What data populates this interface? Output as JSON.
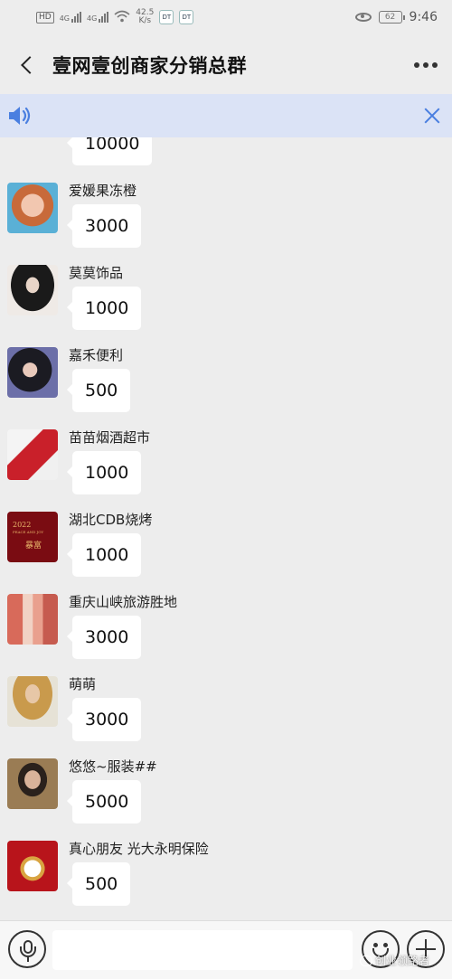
{
  "status_bar": {
    "network_tag": "HD",
    "signal_label_1": "4G",
    "signal_label_2": "4G",
    "speed_value": "42.5",
    "speed_unit": "K/s",
    "battery": "62",
    "time": "9:46"
  },
  "header": {
    "title": "壹网壹创商家分销总群"
  },
  "colors": {
    "background": "#ededed",
    "notice_bg": "#dbe3f6",
    "accent_blue": "#4a7fe0",
    "bubble": "#ffffff"
  },
  "messages": [
    {
      "sender": "",
      "text": "10000",
      "avatar_icon": "avatar-partial"
    },
    {
      "sender": "爱媛果冻橙",
      "text": "3000",
      "avatar_icon": "avatar-portrait"
    },
    {
      "sender": "莫莫饰品",
      "text": "1000",
      "avatar_icon": "avatar-portrait"
    },
    {
      "sender": "嘉禾便利",
      "text": "500",
      "avatar_icon": "avatar-portrait"
    },
    {
      "sender": "苗苗烟酒超市",
      "text": "1000",
      "avatar_icon": "avatar-photo"
    },
    {
      "sender": "湖北CDB烧烤",
      "text": "1000",
      "avatar_icon": "avatar-card",
      "avatar_text_1": "2022",
      "avatar_text_2": "PEACE AND JOY",
      "avatar_text_3": "暴富"
    },
    {
      "sender": "重庆山峡旅游胜地",
      "text": "3000",
      "avatar_icon": "avatar-group"
    },
    {
      "sender": "萌萌",
      "text": "3000",
      "avatar_icon": "avatar-portrait"
    },
    {
      "sender": "悠悠~服装##",
      "text": "5000",
      "avatar_icon": "avatar-portrait"
    },
    {
      "sender": "真心朋友 光大永明保险",
      "text": "500",
      "avatar_icon": "avatar-badge"
    }
  ],
  "watermark": "创业领路者"
}
